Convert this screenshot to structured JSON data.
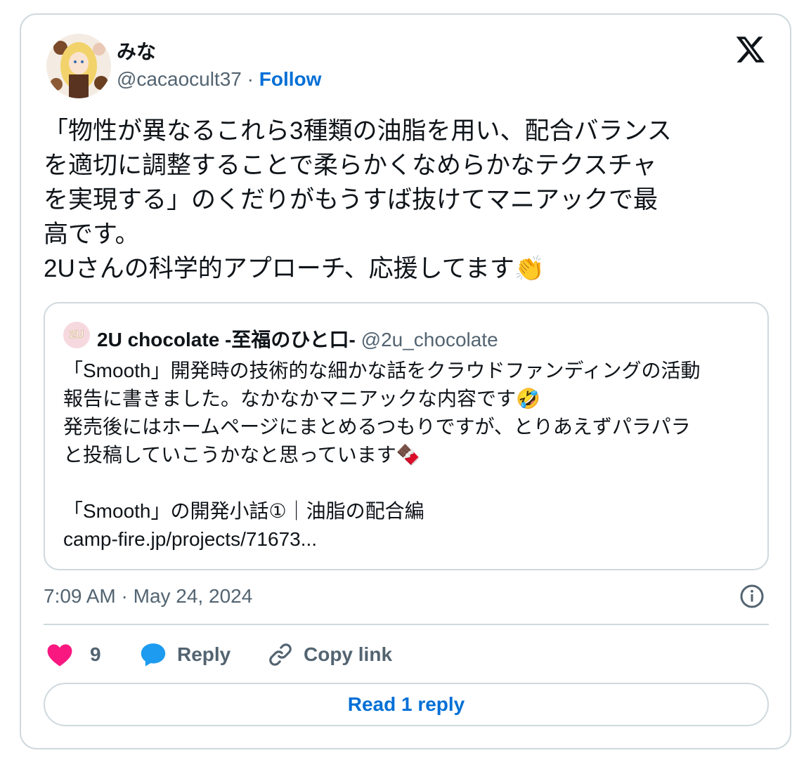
{
  "author": {
    "display_name": "みな",
    "handle": "@cacaocult37",
    "separator": " · ",
    "follow_label": "Follow"
  },
  "tweet": {
    "text": "「物性が異なるこれら3種類の油脂を用い、配合バランス\nを適切に調整することで柔らかくなめらかなテクスチャ\nを実現する」のくだりがもうすば抜けてマニアックで最\n高です。\n2Uさんの科学的アプローチ、応援してます",
    "emoji": "👏"
  },
  "quoted_tweet": {
    "display_name": "2U chocolate -至福のひと口-",
    "handle": "@2u_chocolate",
    "line1": "「Smooth」開発時の技術的な細かな話をクラウドファンディングの活動",
    "line2": "報告に書きました。なかなかマニアックな内容です",
    "line2_emoji": "🤣",
    "line3": "発売後にはホームページにまとめるつもりですが、とりあえずパラパラ",
    "line4": "と投稿していこうかなと思っています",
    "line4_emoji": "🍫",
    "line5": "「Smooth」の開発小話①｜油脂の配合編",
    "line6": "camp-fire.jp/projects/71673..."
  },
  "timestamp": "7:09 AM · May 24, 2024",
  "actions": {
    "like_count": "9",
    "reply_label": "Reply",
    "copy_link_label": "Copy link"
  },
  "read_reply_label": "Read 1 reply",
  "colors": {
    "like": "#f91880",
    "reply": "#1d9bf0",
    "link": "#006fd6",
    "muted": "#536471",
    "border": "#cfd9de"
  }
}
